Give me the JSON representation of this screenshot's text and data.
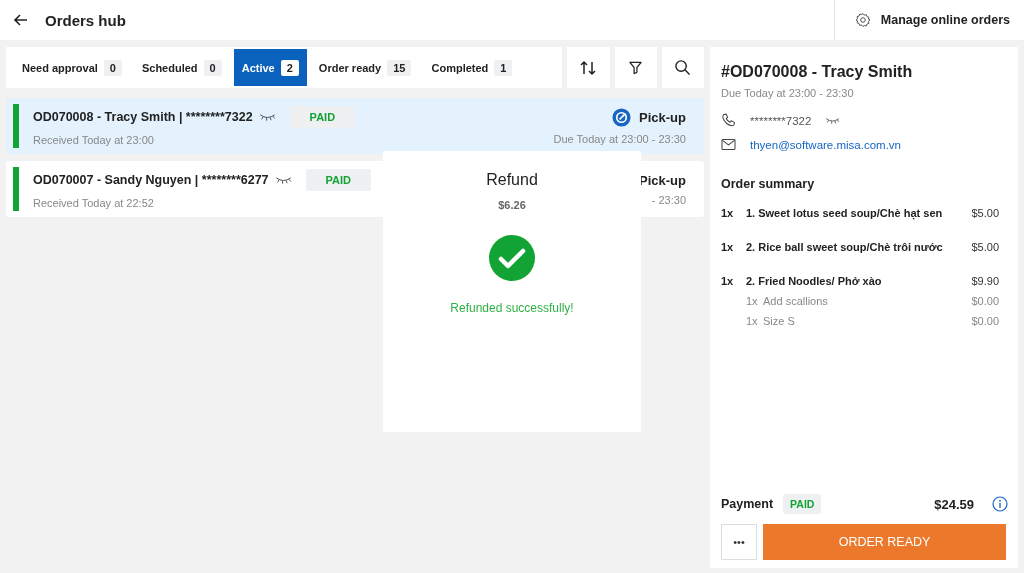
{
  "header": {
    "title": "Orders hub",
    "manage_label": "Manage online orders"
  },
  "tabs": [
    {
      "label": "Need approval",
      "count": "0",
      "selected": false
    },
    {
      "label": "Scheduled",
      "count": "0",
      "selected": false
    },
    {
      "label": "Active",
      "count": "2",
      "selected": true
    },
    {
      "label": "Order ready",
      "count": "15",
      "selected": false
    },
    {
      "label": "Completed",
      "count": "1",
      "selected": false
    }
  ],
  "orders": [
    {
      "title": "OD070008 - Tracy Smith | ********7322",
      "payment": "PAID",
      "fulfillment": "Pick-up",
      "pickup_icon": true,
      "received": "Received Today at 23:00",
      "due": "Due Today at 23:00 - 23:30",
      "selected": true,
      "color": "#12a335"
    },
    {
      "title": "OD070007 - Sandy Nguyen | ********6277",
      "payment": "PAID",
      "fulfillment": "Pick-up",
      "pickup_icon": false,
      "received": "Received Today at 22:52",
      "due": "- 23:30",
      "selected": false,
      "color": "#12a335"
    }
  ],
  "refund_dialog": {
    "title": "Refund",
    "amount": "$6.26",
    "message": "Refunded successfully!"
  },
  "detail": {
    "title": "#OD070008 - Tracy Smith",
    "due": "Due Today at 23:00 - 23:30",
    "phone": "********7322",
    "email": "thyen@software.misa.com.vn",
    "summary_heading": "Order summary",
    "items": [
      {
        "qty": "1x",
        "name": "1. Sweet lotus seed soup/Chè hạt sen",
        "price": "$5.00"
      },
      {
        "qty": "1x",
        "name": "2. Rice ball sweet soup/Chè trôi nước",
        "price": "$5.00"
      },
      {
        "qty": "1x",
        "name": "2. Fried Noodles/ Phở xào",
        "price": "$9.90",
        "options": [
          {
            "qty": "1x",
            "name": "Add scallions",
            "price": "$0.00"
          },
          {
            "qty": "1x",
            "name": "Size S",
            "price": "$0.00"
          }
        ]
      }
    ],
    "payment_label": "Payment",
    "payment_status": "PAID",
    "total": "$24.59",
    "more_label": "•••",
    "primary_action": "ORDER READY"
  }
}
